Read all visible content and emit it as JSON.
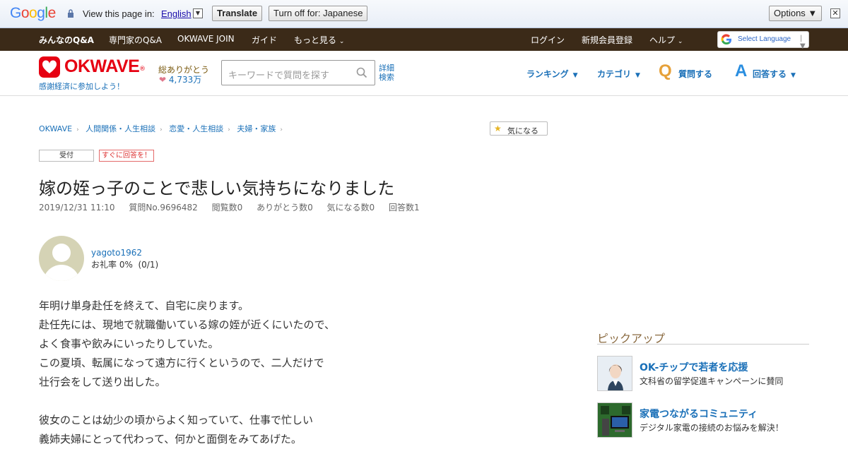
{
  "translate_bar": {
    "logo": "Google",
    "prompt": "View this page in:",
    "language": "English",
    "dropdown_arrow": "▼",
    "translate_label": "Translate",
    "turn_off_label": "Turn off for: Japanese",
    "options_label": "Options ▼",
    "close_glyph": "✕"
  },
  "topnav": {
    "items": [
      "みんなのQ&A",
      "専門家のQ&A",
      "OKWAVE JOIN",
      "ガイド",
      "もっと見る"
    ],
    "right_items": [
      "ログイン",
      "新規会員登録",
      "ヘルプ"
    ],
    "select_language": "Select Language",
    "select_arrow": "▼"
  },
  "header": {
    "logo_text": "OKWAVE",
    "logo_reg": "®",
    "tagline": "感謝経済に参加しよう！",
    "thanks_label": "総ありがとう",
    "thanks_count": "4,733万",
    "search_placeholder": "キーワードで質問を探す",
    "advanced_search": "詳細検索",
    "nav": [
      "ランキング",
      "カテゴリ",
      "質問する",
      "回答する"
    ],
    "q_letter": "Q",
    "a_letter": "A"
  },
  "breadcrumb": [
    "OKWAVE",
    "人間関係・人生相談",
    "恋愛・人生相談",
    "夫婦・家族"
  ],
  "favorite_label": "気になる",
  "tags": [
    "受付",
    "すぐに回答を！"
  ],
  "question": {
    "title": "嫁の姪っ子のことで悲しい気持ちになりました",
    "meta": [
      "2019/12/31 11:10",
      "質問No.9696482",
      "閲覧数0",
      "ありがとう数0",
      "気になる数0",
      "回答数1"
    ],
    "user": "yagoto1962",
    "user_rate": "お礼率 0%  (0/1)",
    "body": [
      "年明け単身赴任を終えて、自宅に戻ります。",
      "赴任先には、現地で就職働いている嫁の姪が近くにいたので、",
      "よく食事や飲みにいったりしていた。",
      "この夏頃、転属になって遠方に行くというので、二人だけで",
      "壮行会をして送り出した。",
      "",
      "彼女のことは幼少の頃からよく知っていて、仕事で忙しい",
      "義姉夫婦にとって代わって、何かと面倒をみてあげた。"
    ]
  },
  "sidebar": {
    "heading": "ピックアップ",
    "items": [
      {
        "title": "OK-チップで若者を応援",
        "desc": "文科省の留学促進キャンペーンに賛同"
      },
      {
        "title": "家電つながるコミュニティ",
        "desc": "デジタル家電の接続のお悩みを解決！"
      }
    ]
  },
  "colors": {
    "brand_red": "#e60012",
    "link_blue": "#1a70b8",
    "nav_brown": "#3b2a18",
    "q_orange": "#e6a13a",
    "a_blue": "#2a8ee0"
  }
}
